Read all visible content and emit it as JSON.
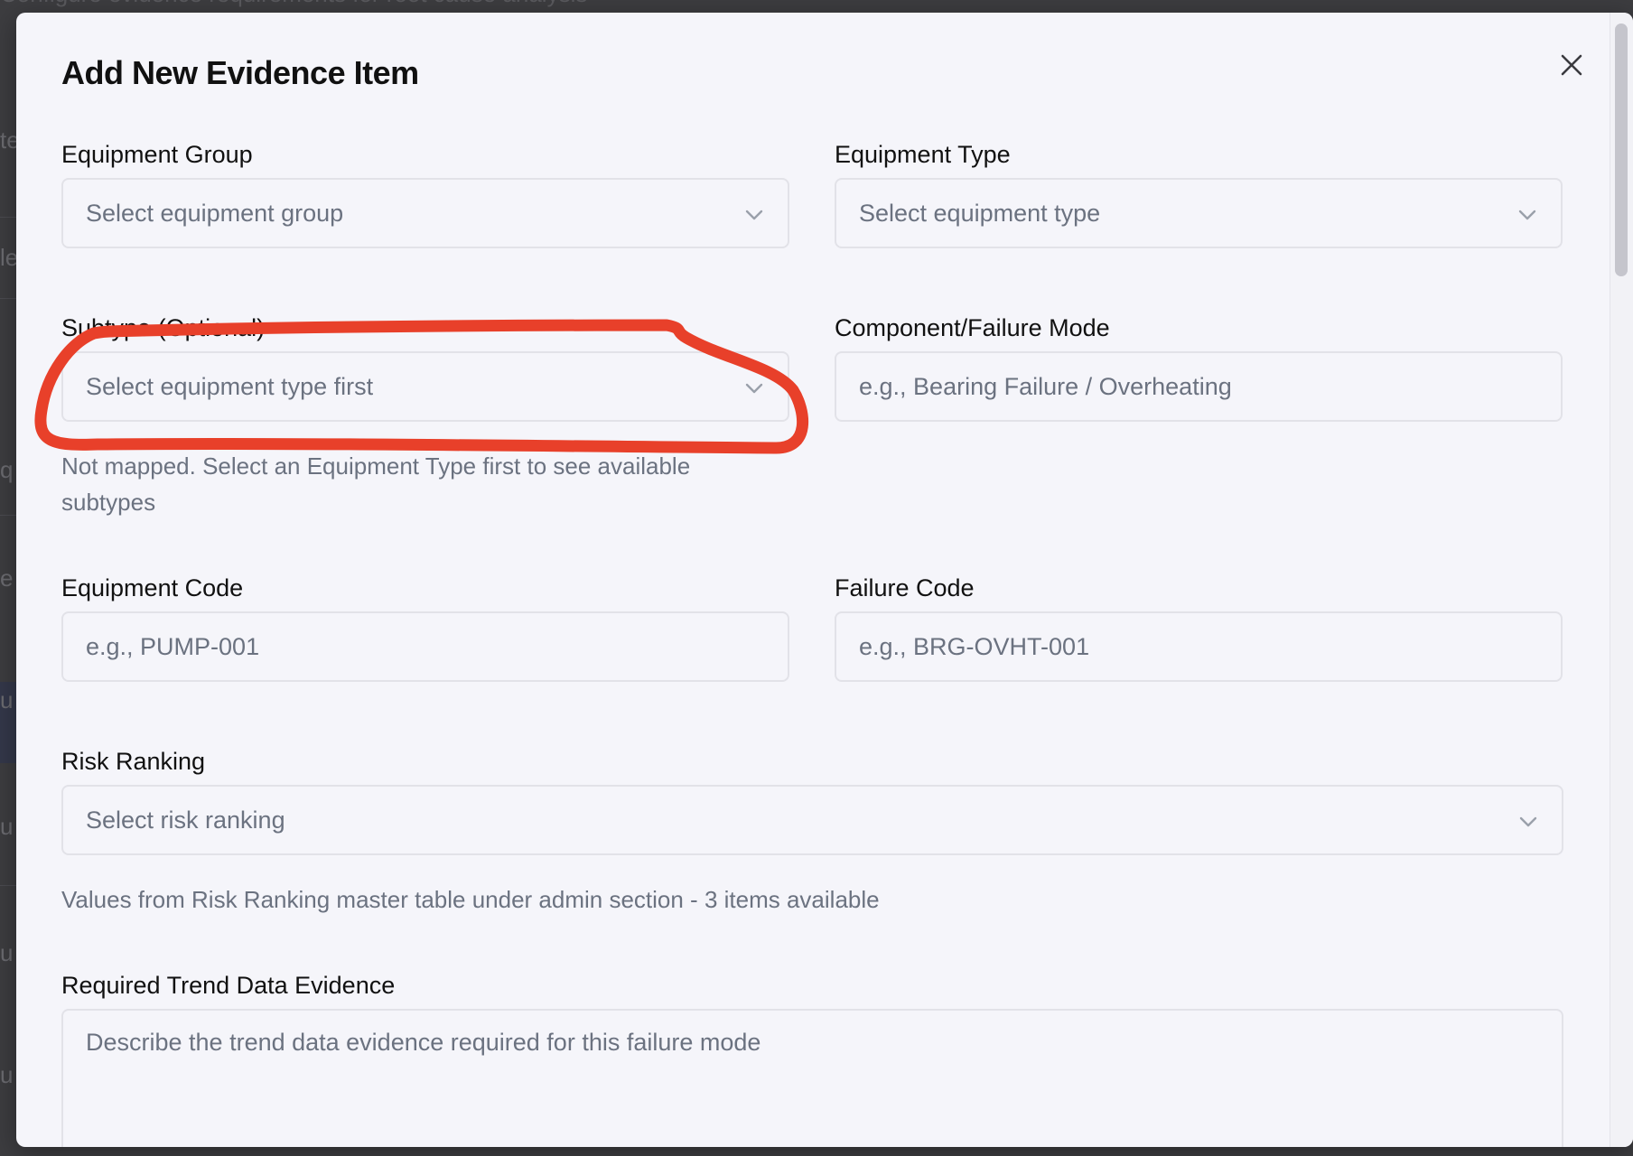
{
  "background": {
    "heading": "Configure evidence requirements for root cause analysis",
    "edge_fragments": [
      "te",
      "le",
      "q",
      "e",
      "u",
      "u",
      "u",
      "u"
    ]
  },
  "modal": {
    "title": "Add New Evidence Item",
    "close_icon": "close-icon"
  },
  "form": {
    "equipment_group": {
      "label": "Equipment Group",
      "placeholder": "Select equipment group"
    },
    "equipment_type": {
      "label": "Equipment Type",
      "placeholder": "Select equipment type"
    },
    "subtype": {
      "label": "Subtype (Optional)",
      "placeholder": "Select equipment type first",
      "helper": "Not mapped. Select an Equipment Type first to see available subtypes"
    },
    "component_failure_mode": {
      "label": "Component/Failure Mode",
      "placeholder": "e.g., Bearing Failure / Overheating"
    },
    "equipment_code": {
      "label": "Equipment Code",
      "placeholder": "e.g., PUMP-001"
    },
    "failure_code": {
      "label": "Failure Code",
      "placeholder": "e.g., BRG-OVHT-001"
    },
    "risk_ranking": {
      "label": "Risk Ranking",
      "placeholder": "Select risk ranking",
      "helper": "Values from Risk Ranking master table under admin section - 3 items available"
    },
    "trend_data": {
      "label": "Required Trend Data Evidence",
      "placeholder": "Describe the trend data evidence required for this failure mode"
    }
  },
  "colors": {
    "annotation": "#e8402a",
    "modal_bg": "#f5f5fa",
    "border": "#e2e2e8",
    "placeholder": "#6b7280"
  }
}
